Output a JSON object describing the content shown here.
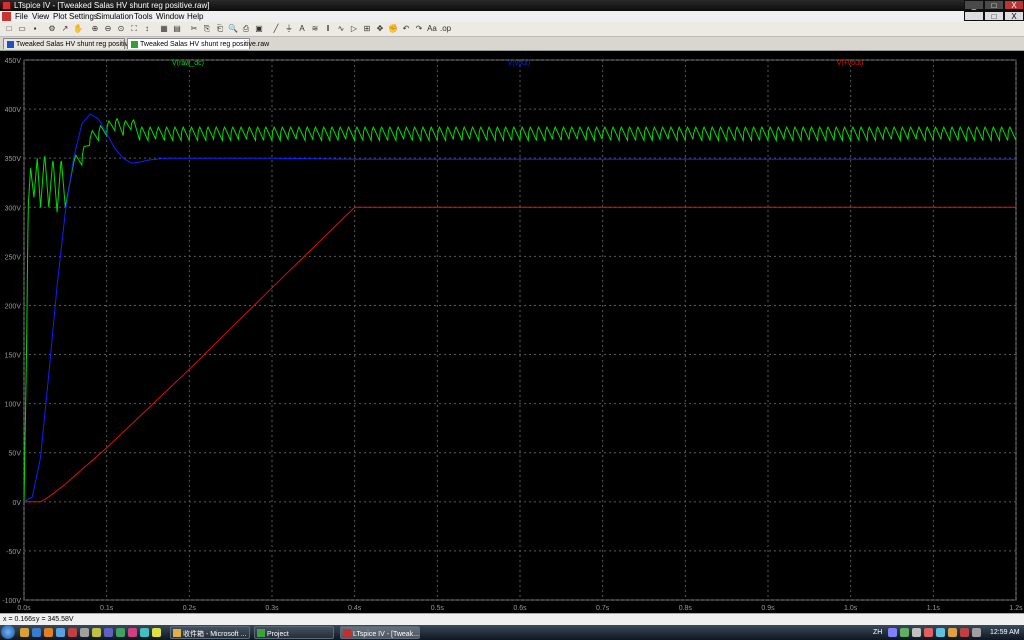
{
  "window": {
    "title": "LTspice IV - [Tweaked Salas HV shunt reg positive.raw]",
    "controls": [
      "_",
      "□",
      "X"
    ],
    "doc_controls": [
      "_",
      "□",
      "X"
    ]
  },
  "menu": [
    "File",
    "View",
    "Plot Settings",
    "Simulation",
    "Tools",
    "Window",
    "Help"
  ],
  "toolbar_icons": [
    "new-icon",
    "open-icon",
    "save-icon",
    "control-panel-icon",
    "run-icon",
    "halt-icon",
    "zoom-in-icon",
    "zoom-out-icon",
    "zoom-fit-icon",
    "zoom-extents-icon",
    "autorange-icon",
    "tile-icon",
    "cascade-icon",
    "cut-icon",
    "copy-icon",
    "paste-icon",
    "find-icon",
    "print-icon",
    "print-preview-icon",
    "wire-icon",
    "ground-icon",
    "label-icon",
    "resistor-icon",
    "capacitor-icon",
    "inductor-icon",
    "diode-icon",
    "component-icon",
    "move-icon",
    "drag-icon",
    "undo-icon",
    "redo-icon",
    "text-icon",
    "spice-directive-icon"
  ],
  "tabs": [
    {
      "label": "Tweaked Salas HV shunt reg positive.asc"
    },
    {
      "label": "Tweaked Salas HV shunt reg positive.raw"
    }
  ],
  "chart_data": {
    "type": "line",
    "title": "",
    "xlabel": "",
    "ylabel": "",
    "xlim": [
      0,
      1.2
    ],
    "ylim": [
      -100,
      450
    ],
    "grid": true,
    "x_ticks": [
      "0.0s",
      "0.1s",
      "0.2s",
      "0.3s",
      "0.4s",
      "0.5s",
      "0.6s",
      "0.7s",
      "0.8s",
      "0.9s",
      "1.0s",
      "1.1s",
      "1.2s"
    ],
    "x_tick_values": [
      0,
      0.1,
      0.2,
      0.3,
      0.4,
      0.5,
      0.6,
      0.7,
      0.8,
      0.9,
      1.0,
      1.1,
      1.2
    ],
    "y_ticks": [
      "450V",
      "400V",
      "350V",
      "300V",
      "250V",
      "200V",
      "150V",
      "100V",
      "50V",
      "0V",
      "-50V",
      "-100V"
    ],
    "y_tick_values": [
      450,
      400,
      350,
      300,
      250,
      200,
      150,
      100,
      50,
      0,
      -50,
      -100
    ],
    "series": [
      {
        "name": "V(raw_dc)",
        "color": "#00dd00",
        "x": [
          0,
          0.003,
          0.005,
          0.008,
          0.012,
          0.016,
          0.02,
          0.025,
          0.03,
          0.035,
          0.04,
          0.045,
          0.05,
          0.06,
          0.07,
          0.08,
          0.09,
          0.1,
          0.11,
          0.12,
          0.13,
          0.14,
          0.15,
          0.2,
          0.4,
          0.6,
          0.8,
          1.0,
          1.2
        ],
        "y": [
          0,
          150,
          300,
          340,
          310,
          350,
          300,
          355,
          300,
          350,
          295,
          350,
          300,
          345,
          350,
          370,
          375,
          380,
          385,
          380,
          385,
          375,
          375,
          375,
          375,
          375,
          375,
          375,
          375
        ],
        "ripple_amplitude": 7,
        "ripple_period": 0.01
      },
      {
        "name": "V(vout)",
        "color": "#1020ff",
        "x": [
          0,
          0.01,
          0.02,
          0.03,
          0.04,
          0.05,
          0.06,
          0.07,
          0.08,
          0.09,
          0.1,
          0.11,
          0.12,
          0.13,
          0.14,
          0.15,
          0.17,
          0.2,
          0.3,
          0.4,
          0.6,
          0.8,
          1.0,
          1.2
        ],
        "y": [
          0,
          5,
          45,
          130,
          220,
          295,
          350,
          385,
          395,
          390,
          375,
          360,
          350,
          345,
          346,
          348,
          350,
          350,
          350,
          349,
          349,
          349,
          349,
          349
        ]
      },
      {
        "name": "V(+vout)",
        "color": "#e01010",
        "x": [
          0,
          0.01,
          0.02,
          0.03,
          0.05,
          0.1,
          0.2,
          0.3,
          0.4,
          0.6,
          0.8,
          1.0,
          1.2
        ],
        "y": [
          0,
          0,
          0,
          5,
          18,
          55,
          135,
          218,
          300,
          300,
          300,
          300,
          300
        ]
      }
    ]
  },
  "status": {
    "x_readout": "x = 0.166s",
    "y_readout": "y = 345.58V"
  },
  "taskbar": {
    "tasks": [
      {
        "label": "收件箱 - Microsoft ..."
      },
      {
        "label": "Project"
      },
      {
        "label": "LTspice IV - [Tweak..."
      }
    ],
    "lang": "ZH",
    "clock": "12:59 AM"
  },
  "colors": {
    "plot_bg": "#000000",
    "grid": "#5a5a5a",
    "axis_text": "#9a9a9a"
  }
}
